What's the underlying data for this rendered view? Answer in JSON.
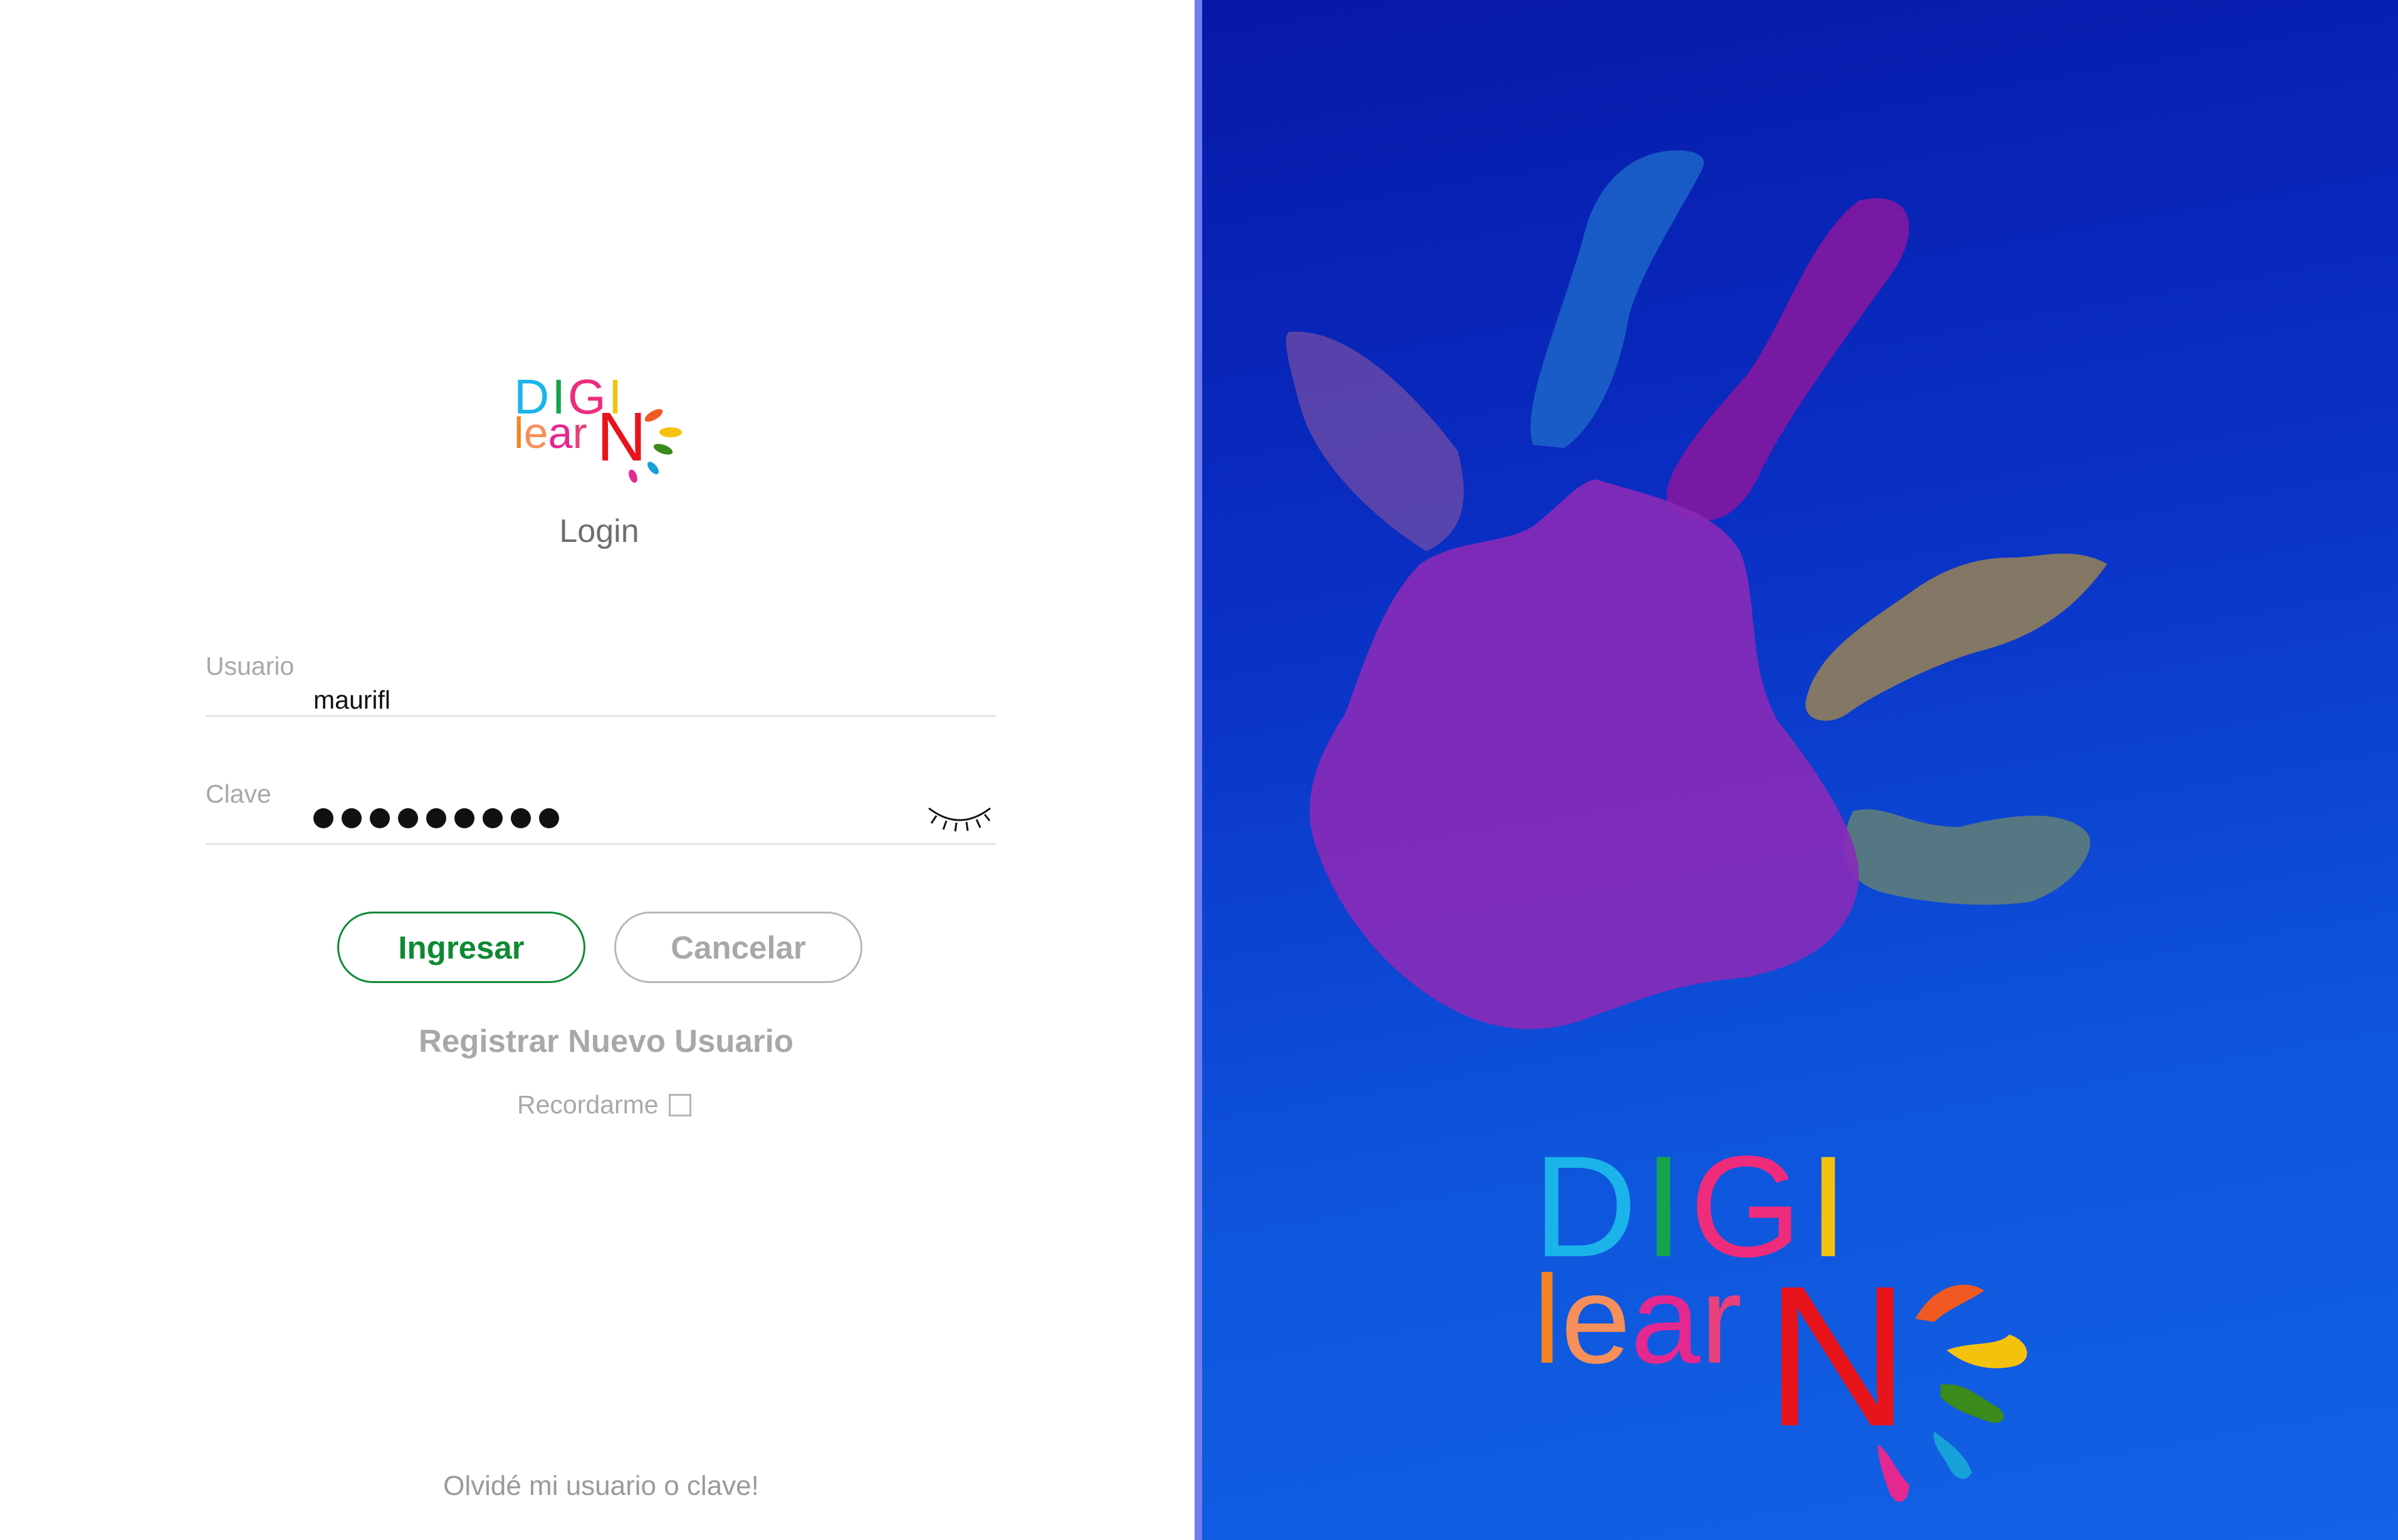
{
  "brand": {
    "logo_line1": "DIGI",
    "logo_line2": "learN",
    "colors": {
      "D": "#1ab4ea",
      "I1": "#16a34a",
      "G": "#ef2b7c",
      "I2": "#f4c20d",
      "l": "#f58220",
      "e": "#f78f5a",
      "a": "#e4288f",
      "r": "#e8407a",
      "N": "#e8141c",
      "panel_top": "#0718a8",
      "panel_bottom": "#1262e6"
    }
  },
  "login": {
    "title": "Login",
    "username": {
      "label": "Usuario",
      "value": "maurifl"
    },
    "password": {
      "label": "Clave",
      "masked_length": 9,
      "toggle_icon": "eye-closed-icon"
    },
    "submit_label": "Ingresar",
    "cancel_label": "Cancelar",
    "register_label": "Registrar Nuevo Usuario",
    "remember_label": "Recordarme",
    "remember_checked": false,
    "forgot_label": "Olvidé mi usuario o clave!",
    "accent_color": "#0e8a33"
  }
}
